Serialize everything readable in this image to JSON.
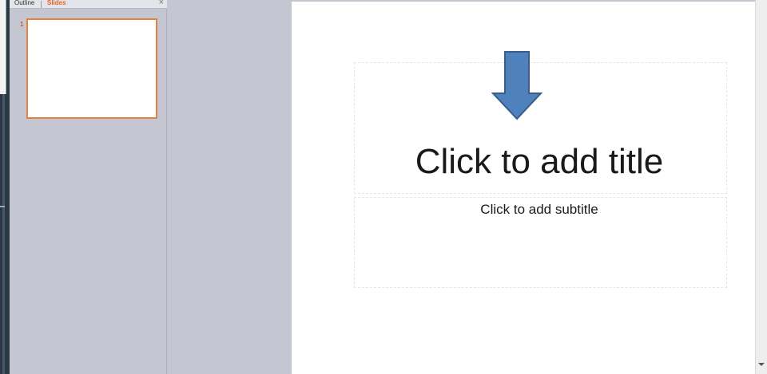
{
  "panel": {
    "tabs": {
      "outline": "Outline",
      "slides": "Slides"
    },
    "close_glyph": "×",
    "slide_number": "1"
  },
  "slide": {
    "title_placeholder": "Click to add title",
    "subtitle_placeholder": "Click to add subtitle"
  },
  "colors": {
    "arrow_fill": "#4f81bd",
    "arrow_stroke": "#385d8a",
    "selected_tab": "#e0662a",
    "thumbnail_border": "#e8803e"
  },
  "icons": {
    "arrow": "down-arrow-shape",
    "close": "close-icon",
    "scroll_down": "chevron-down-icon"
  }
}
